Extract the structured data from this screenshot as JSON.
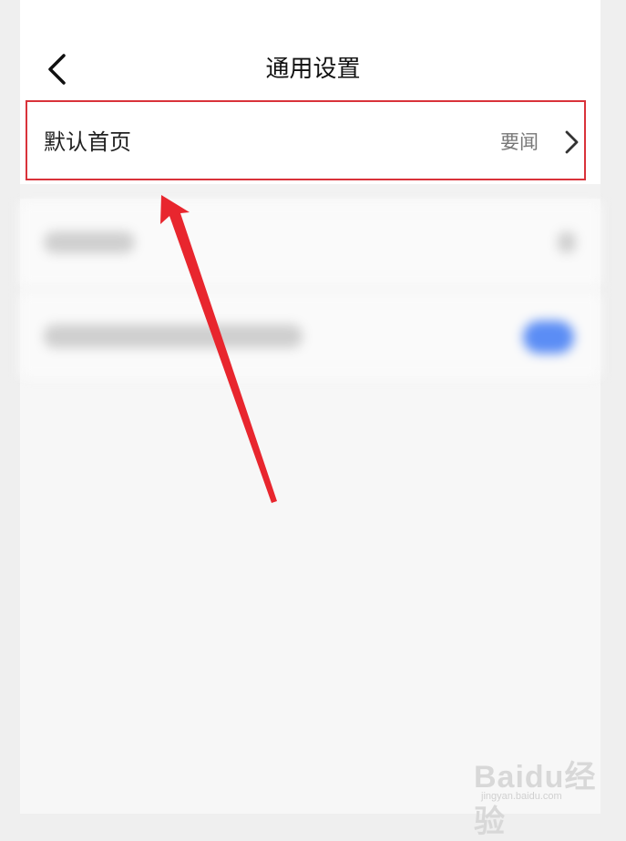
{
  "header": {
    "title": "通用设置"
  },
  "settings": {
    "default_home": {
      "label": "默认首页",
      "value": "要闻"
    }
  },
  "annotation": {
    "highlight_color": "#d9323a",
    "arrow_color": "#e8262e"
  },
  "watermark": {
    "brand": "Baidu经验",
    "url": "jingyan.baidu.com"
  }
}
